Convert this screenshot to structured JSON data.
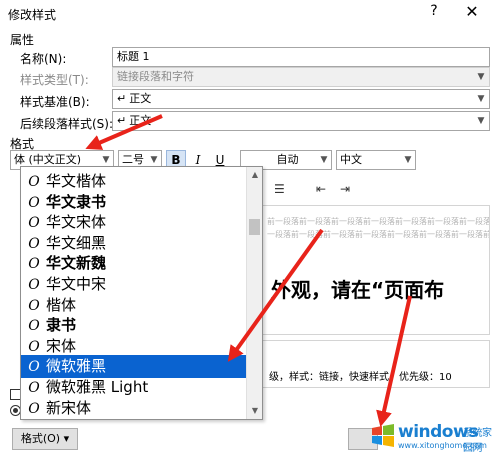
{
  "window": {
    "title": "修改样式",
    "help": "?",
    "close": "✕"
  },
  "properties": {
    "section_label": "属性",
    "name_label": "名称(N):",
    "name_value": "标题 1",
    "type_label": "样式类型(T):",
    "type_value": "链接段落和字符",
    "based_label": "样式基准(B):",
    "based_value": "正文",
    "next_label": "后续段落样式(S):",
    "next_value": "正文",
    "para_mark": "↵"
  },
  "format": {
    "section_label": "格式",
    "font_value": "体 (中文正文)",
    "size_value": "二号",
    "bold": "B",
    "italic": "I",
    "underline": "U",
    "color_value": "自动",
    "script_value": "中文"
  },
  "font_list": {
    "items": [
      {
        "label": "华文楷体",
        "icon": "O"
      },
      {
        "label": "华文隶书",
        "icon": "O"
      },
      {
        "label": "华文宋体",
        "icon": "O"
      },
      {
        "label": "华文细黑",
        "icon": "O"
      },
      {
        "label": "华文新魏",
        "icon": "O"
      },
      {
        "label": "华文中宋",
        "icon": "O"
      },
      {
        "label": "楷体",
        "icon": "O"
      },
      {
        "label": "隶书",
        "icon": "O"
      },
      {
        "label": "宋体",
        "icon": "O"
      },
      {
        "label": "微软雅黑",
        "icon": "O"
      },
      {
        "label": "微软雅黑 Light",
        "icon": "O"
      },
      {
        "label": "新宋体",
        "icon": "O"
      }
    ],
    "selected_index": 9
  },
  "preview": {
    "ghost_line_1": "前一段落前一段落前一段落前一段落前一段落前一段落前一段落前一",
    "ghost_line_2": "一段落前一段落前一段落前一段落前一段落前一段落前一段落前一段落",
    "sample_text": "外观，请在“页面布"
  },
  "description": {
    "text": "级，样式：链接，快速样式，优先级：10"
  },
  "buttons": {
    "format": "格式(O) ▾"
  },
  "watermark": {
    "brand": "windows",
    "site": "系统家园网",
    "url": "www.xitonghome.com"
  },
  "colors": {
    "selection": "#0a63d0",
    "arrow": "#e8231a",
    "watermark": "#1a7fd0"
  }
}
